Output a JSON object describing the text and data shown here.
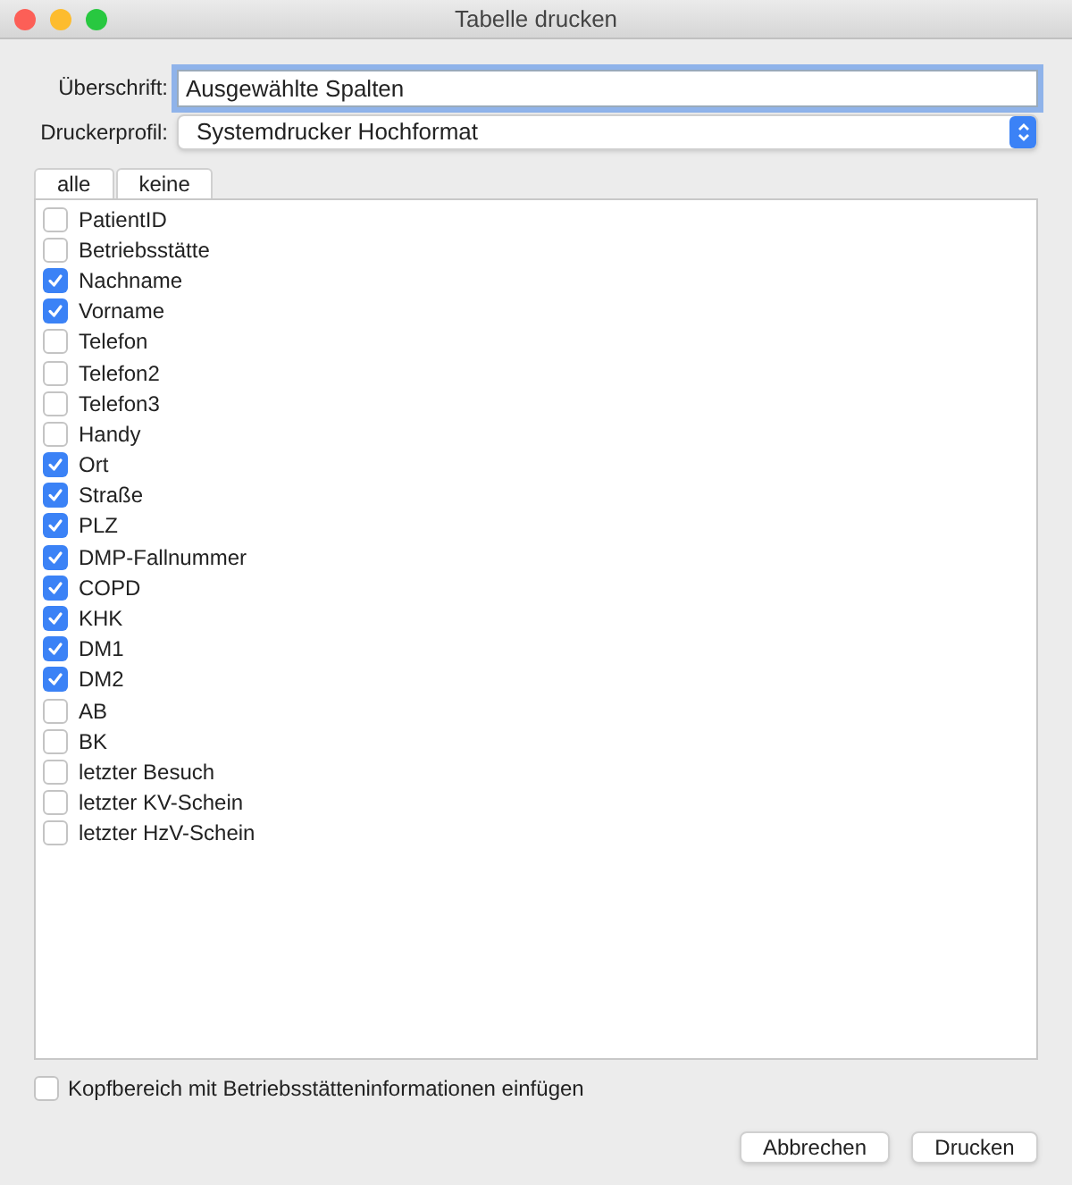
{
  "window": {
    "title": "Tabelle drucken"
  },
  "heading_field": {
    "label": "Überschrift:",
    "value": "Ausgewählte Spalten"
  },
  "printer_profile": {
    "label": "Druckerprofil:",
    "value": "Systemdrucker Hochformat"
  },
  "selection_buttons": [
    "alle",
    "keine"
  ],
  "columns": [
    {
      "label": "PatientID",
      "checked": false
    },
    {
      "label": "Betriebsstätte",
      "checked": false
    },
    {
      "label": "Nachname",
      "checked": true
    },
    {
      "label": "Vorname",
      "checked": true
    },
    {
      "label": "Telefon",
      "checked": false
    },
    {
      "label": "Telefon2",
      "checked": false
    },
    {
      "label": "Telefon3",
      "checked": false
    },
    {
      "label": "Handy",
      "checked": false
    },
    {
      "label": "Ort",
      "checked": true
    },
    {
      "label": "Straße",
      "checked": true
    },
    {
      "label": "PLZ",
      "checked": true
    },
    {
      "label": "DMP-Fallnummer",
      "checked": true
    },
    {
      "label": "COPD",
      "checked": true
    },
    {
      "label": "KHK",
      "checked": true
    },
    {
      "label": "DM1",
      "checked": true
    },
    {
      "label": "DM2",
      "checked": true
    },
    {
      "label": "AB",
      "checked": false
    },
    {
      "label": "BK",
      "checked": false
    },
    {
      "label": "letzter Besuch",
      "checked": false
    },
    {
      "label": "letzter KV-Schein",
      "checked": false
    },
    {
      "label": "letzter HzV-Schein",
      "checked": false
    }
  ],
  "header_option": {
    "label": "Kopfbereich mit Betriebsstätteninformationen einfügen",
    "checked": false
  },
  "buttons": [
    "Abbrechen",
    "Drucken"
  ]
}
